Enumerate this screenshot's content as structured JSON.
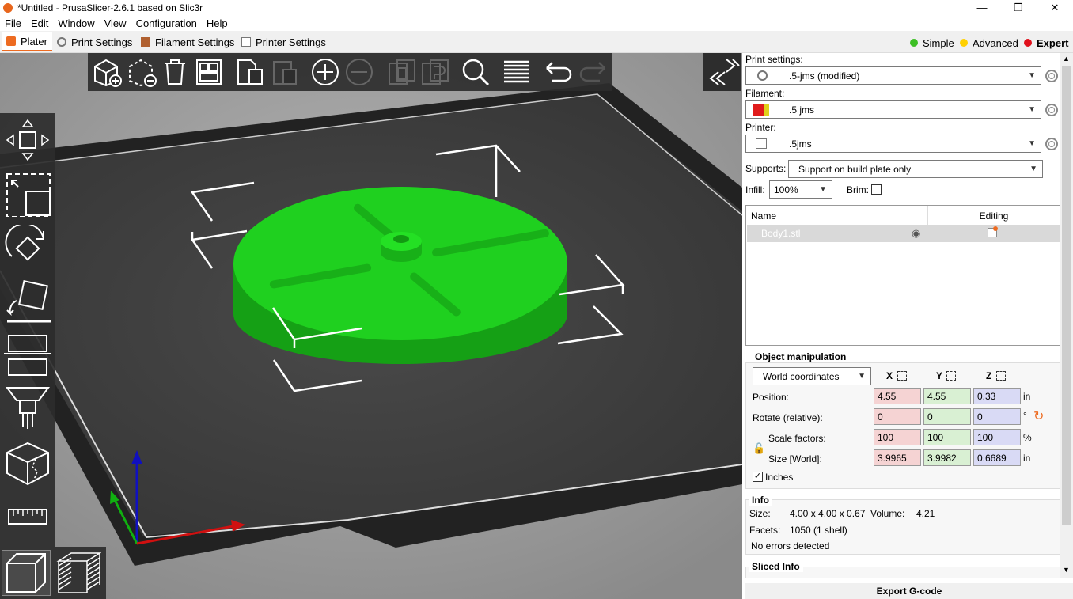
{
  "window": {
    "title": "*Untitled - PrusaSlicer-2.6.1 based on Slic3r",
    "minimize": "—",
    "maximize": "❐",
    "close": "✕"
  },
  "menu": [
    "File",
    "Edit",
    "Window",
    "View",
    "Configuration",
    "Help"
  ],
  "tabs": [
    {
      "label": "Plater",
      "icon": "plater-icon",
      "active": true
    },
    {
      "label": "Print Settings",
      "icon": "gear-icon"
    },
    {
      "label": "Filament Settings",
      "icon": "spool-icon"
    },
    {
      "label": "Printer Settings",
      "icon": "printer-icon"
    }
  ],
  "modes": [
    {
      "label": "Simple",
      "color": "#3dbf25"
    },
    {
      "label": "Advanced",
      "color": "#ffd000"
    },
    {
      "label": "Expert",
      "color": "#e0101b",
      "active": true
    }
  ],
  "top_toolbar": [
    "add-icon",
    "delete-icon",
    "delete-all-icon",
    "arrange-icon",
    "copy-icon",
    "paste-icon",
    "add-instance-icon",
    "remove-instance-icon",
    "split-objects-icon",
    "split-parts-icon",
    "search-icon",
    "layers-editing-icon",
    "undo-icon",
    "redo-icon"
  ],
  "left_toolbar": [
    "move-icon",
    "scale-icon",
    "rotate-icon",
    "place-on-face-icon",
    "cut-icon",
    "paint-supports-icon",
    "seam-paint-icon",
    "measure-icon"
  ],
  "view_toggles": [
    "3d-view-icon",
    "preview-icon"
  ],
  "sidebar": {
    "print_settings_label": "Print settings:",
    "print_settings_value": ".5-jms (modified)",
    "filament_label": "Filament:",
    "filament_value": ".5 jms",
    "filament_colors": [
      "#e01b1b",
      "#e0d01b"
    ],
    "printer_label": "Printer:",
    "printer_value": ".5jms",
    "supports_label": "Supports:",
    "supports_value": "Support on build plate only",
    "infill_label": "Infill:",
    "infill_value": "100%",
    "brim_label": "Brim:",
    "brim_checked": false,
    "list_headers": {
      "name": "Name",
      "editing": "Editing"
    },
    "objects": [
      {
        "name": "Body1.stl",
        "visible": true
      }
    ]
  },
  "object_manipulation": {
    "title": "Object manipulation",
    "coord_system": "World coordinates",
    "axis_labels": [
      "X",
      "Y",
      "Z"
    ],
    "position_label": "Position:",
    "position": [
      "4.55",
      "4.55",
      "0.33"
    ],
    "position_unit": "in",
    "rotate_label": "Rotate (relative):",
    "rotate": [
      "0",
      "0",
      "0"
    ],
    "rotate_unit": "°",
    "scale_label": "Scale factors:",
    "scale": [
      "100",
      "100",
      "100"
    ],
    "scale_unit": "%",
    "size_label": "Size [World]:",
    "size": [
      "3.9965",
      "3.9982",
      "0.6689"
    ],
    "size_unit": "in",
    "inches_label": "Inches",
    "inches_checked": true
  },
  "info": {
    "title": "Info",
    "size_label": "Size:",
    "size_value": "4.00 x 4.00 x 0.67",
    "volume_label": "Volume:",
    "volume_value": "4.21",
    "facets_label": "Facets:",
    "facets_value": "1050 (1 shell)",
    "errors": "No errors detected"
  },
  "sliced_info_title": "Sliced Info",
  "export_label": "Export G-code",
  "colors": {
    "accent": "#ed6b21",
    "model": "#1fd01f",
    "bed": "#3a3a3a"
  }
}
